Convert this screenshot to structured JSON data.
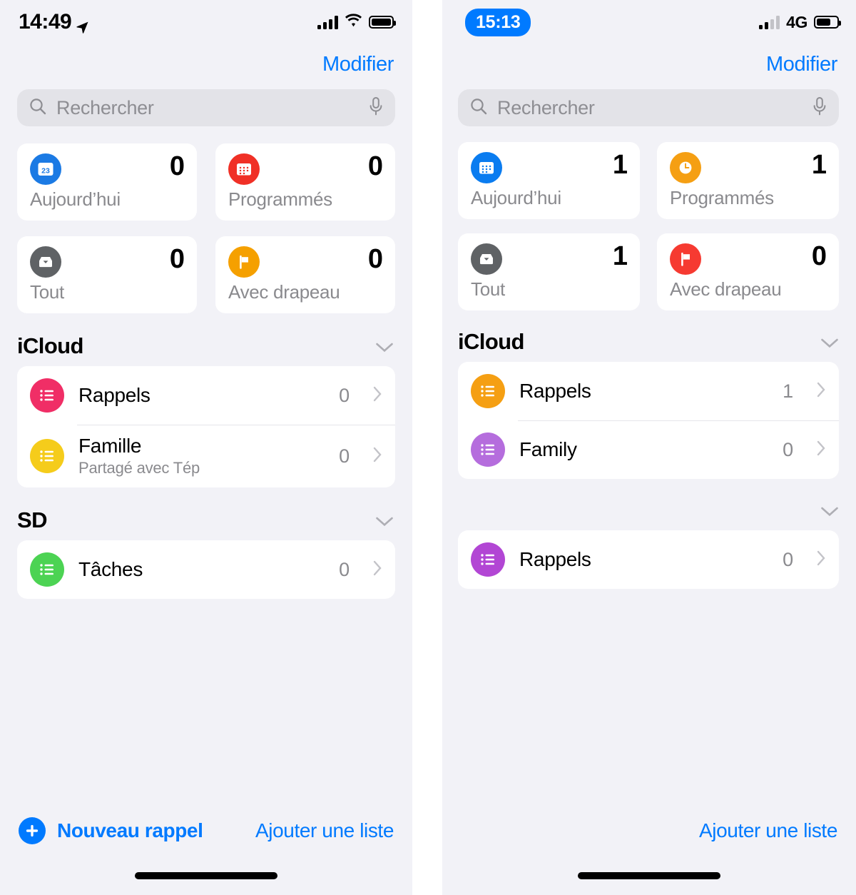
{
  "colors": {
    "accent": "#007aff",
    "background": "#f2f2f7",
    "card": "#ffffff",
    "secondary_text": "#8a8a8e",
    "separator": "#e5e5ea",
    "search_field": "#e3e3e8"
  },
  "left": {
    "status": {
      "time": "14:49",
      "location_icon": "location-arrow-icon",
      "signal_icon": "cellular-bars-icon",
      "wifi_icon": "wifi-icon",
      "battery_icon": "battery-full-icon"
    },
    "nav": {
      "edit_label": "Modifier"
    },
    "search": {
      "placeholder": "Rechercher",
      "search_icon": "search-icon",
      "mic_icon": "microphone-icon"
    },
    "smart_lists": [
      {
        "label": "Aujourd’hui",
        "count": "0",
        "icon": "calendar-day-icon",
        "color": "#1b7ae4",
        "day": "23"
      },
      {
        "label": "Programmés",
        "count": "0",
        "icon": "calendar-grid-icon",
        "color": "#f03026"
      },
      {
        "label": "Tout",
        "count": "0",
        "icon": "inbox-tray-icon",
        "color": "#5f6265"
      },
      {
        "label": "Avec drapeau",
        "count": "0",
        "icon": "flag-icon",
        "color": "#f5a000"
      }
    ],
    "sections": [
      {
        "title": "iCloud",
        "chevron_icon": "chevron-down-icon",
        "lists": [
          {
            "title": "Rappels",
            "subtitle": "",
            "count": "0",
            "icon": "list-bullet-icon",
            "color": "#f02e66",
            "chevron_icon": "chevron-right-icon"
          },
          {
            "title": "Famille",
            "subtitle": "Partagé avec Tép",
            "count": "0",
            "icon": "list-bullet-icon",
            "color": "#f5cc1b",
            "chevron_icon": "chevron-right-icon"
          }
        ]
      },
      {
        "title": "SD",
        "chevron_icon": "chevron-down-icon",
        "lists": [
          {
            "title": "Tâches",
            "subtitle": "",
            "count": "0",
            "icon": "list-bullet-icon",
            "color": "#4cd353",
            "chevron_icon": "chevron-right-icon"
          }
        ]
      }
    ],
    "bottom": {
      "new_reminder_label": "Nouveau rappel",
      "new_reminder_icon": "plus-circle-icon",
      "add_list_label": "Ajouter une liste"
    }
  },
  "right": {
    "status": {
      "time": "15:13",
      "time_is_pill": true,
      "signal_icon": "cellular-bars-icon",
      "network_label": "4G",
      "battery_icon": "battery-high-icon"
    },
    "nav": {
      "edit_label": "Modifier"
    },
    "search": {
      "placeholder": "Rechercher",
      "search_icon": "search-icon",
      "mic_icon": "microphone-icon"
    },
    "smart_lists": [
      {
        "label": "Aujourd’hui",
        "count": "1",
        "icon": "calendar-grid-icon",
        "color": "#0a7cf0",
        "day": ""
      },
      {
        "label": "Programmés",
        "count": "1",
        "icon": "clock-icon",
        "color": "#f59f13"
      },
      {
        "label": "Tout",
        "count": "1",
        "icon": "inbox-tray-icon",
        "color": "#5f6265"
      },
      {
        "label": "Avec drapeau",
        "count": "0",
        "icon": "flag-icon",
        "color": "#f63a31"
      }
    ],
    "sections": [
      {
        "title": "iCloud",
        "chevron_icon": "chevron-down-icon",
        "lists": [
          {
            "title": "Rappels",
            "subtitle": "",
            "count": "1",
            "icon": "list-bullet-icon",
            "color": "#f59f13",
            "chevron_icon": "chevron-right-icon"
          },
          {
            "title": "Family",
            "subtitle": "",
            "count": "0",
            "icon": "list-bullet-icon",
            "color": "#b56ddd",
            "chevron_icon": "chevron-right-icon"
          }
        ]
      },
      {
        "title": "",
        "chevron_icon": "chevron-down-icon",
        "lists": [
          {
            "title": "Rappels",
            "subtitle": "",
            "count": "0",
            "icon": "list-bullet-icon",
            "color": "#b246d4",
            "chevron_icon": "chevron-right-icon"
          }
        ]
      }
    ],
    "bottom": {
      "new_reminder_label": "",
      "add_list_label": "Ajouter une liste"
    }
  }
}
